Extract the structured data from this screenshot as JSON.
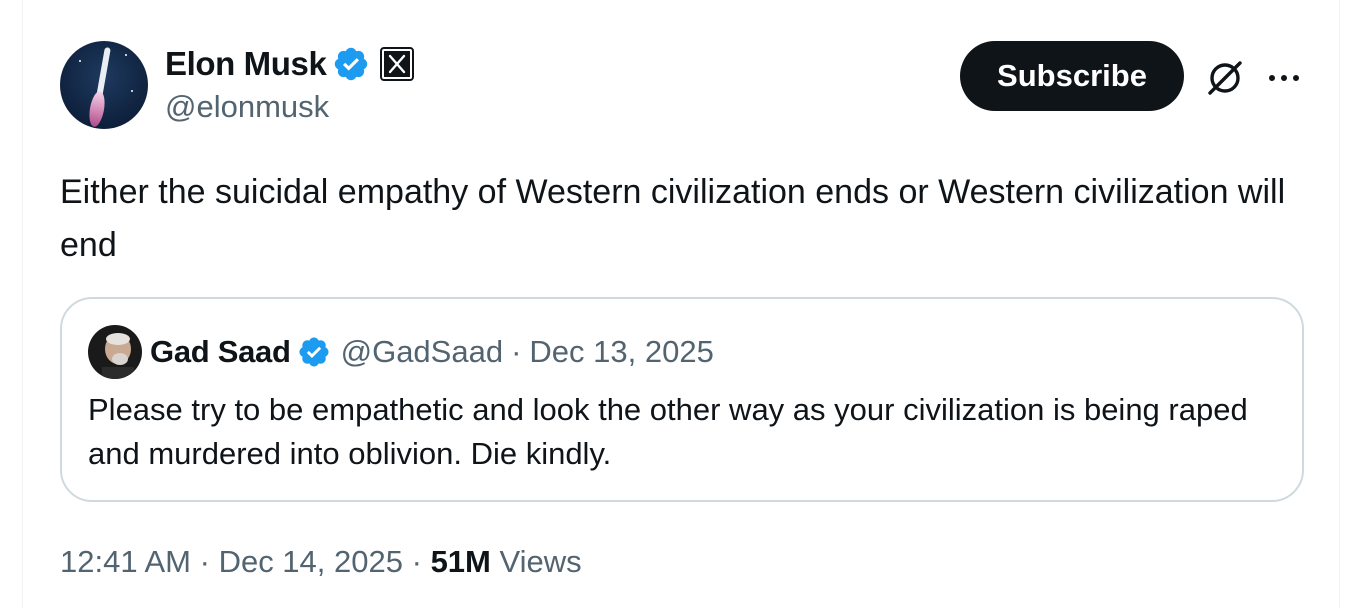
{
  "tweet": {
    "author": {
      "display_name": "Elon Musk",
      "handle": "@elonmusk",
      "verified_icon": "verified-badge-icon",
      "affiliation_icon": "x-logo-icon"
    },
    "actions": {
      "subscribe_label": "Subscribe",
      "grok_icon": "grok-icon",
      "more_icon": "more-icon"
    },
    "text": "Either the suicidal empathy of Western civilization ends or Western civilization will end",
    "quoted": {
      "display_name": "Gad Saad",
      "handle": "@GadSaad",
      "separator": "·",
      "date": "Dec 13, 2025",
      "text": "Please try to be empathetic and look the other way as your civilization is being raped and murdered into oblivion. Die kindly."
    },
    "meta": {
      "time": "12:41 AM",
      "separator": "·",
      "date": "Dec 14, 2025",
      "views_count": "51M",
      "views_label": "Views"
    }
  },
  "colors": {
    "text_primary": "#0f1419",
    "text_secondary": "#536471",
    "verified_blue": "#1d9bf0",
    "border": "#cfd9de",
    "button_dark": "#0f1419"
  }
}
